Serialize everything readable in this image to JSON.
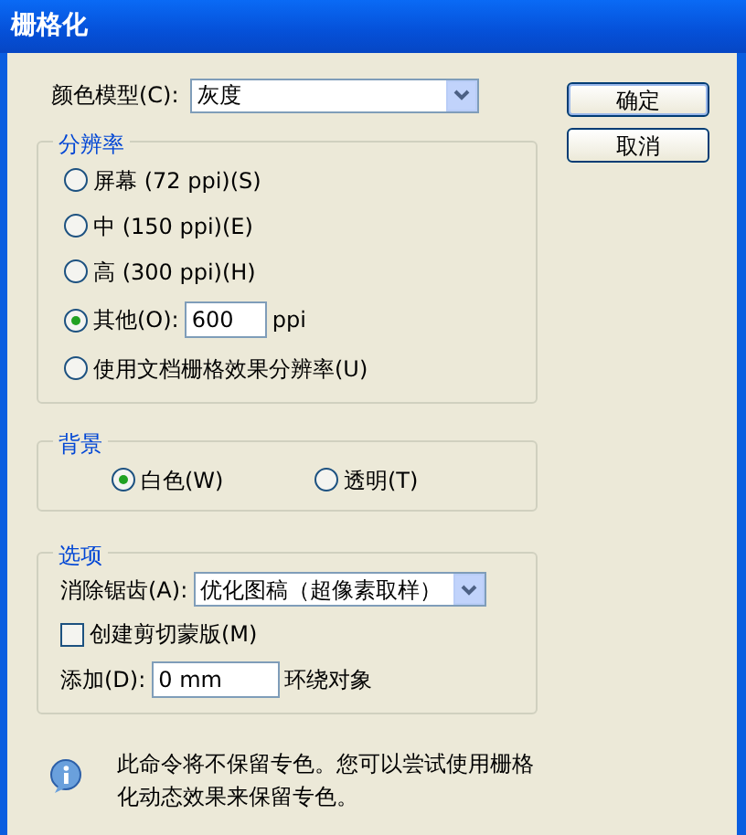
{
  "window": {
    "title": "栅格化"
  },
  "color_model": {
    "label": "颜色模型(C):",
    "value": "灰度"
  },
  "buttons": [
    {
      "label": "确定",
      "default": true
    },
    {
      "label": "取消",
      "default": false
    }
  ],
  "resolution": {
    "legend": "分辨率",
    "options": [
      {
        "label": "屏幕 (72 ppi)(S)",
        "selected": false
      },
      {
        "label": "中 (150 ppi)(E)",
        "selected": false
      },
      {
        "label": "高 (300 ppi)(H)",
        "selected": false
      },
      {
        "label": "其他(O):",
        "selected": true,
        "value": "600",
        "unit": "ppi"
      },
      {
        "label": "使用文档栅格效果分辨率(U)",
        "selected": false
      }
    ]
  },
  "background": {
    "legend": "背景",
    "options": [
      {
        "label": "白色(W)",
        "selected": true
      },
      {
        "label": "透明(T)",
        "selected": false
      }
    ]
  },
  "options": {
    "legend": "选项",
    "antialias": {
      "label": "消除锯齿(A):",
      "value": "优化图稿（超像素取样）"
    },
    "clipping_mask": {
      "label": "创建剪切蒙版(M)",
      "checked": false
    },
    "add": {
      "label": "添加(D):",
      "value": "0 mm",
      "suffix": "环绕对象"
    }
  },
  "note": "此命令将不保留专色。您可以尝试使用栅格化动态效果来保留专色。"
}
